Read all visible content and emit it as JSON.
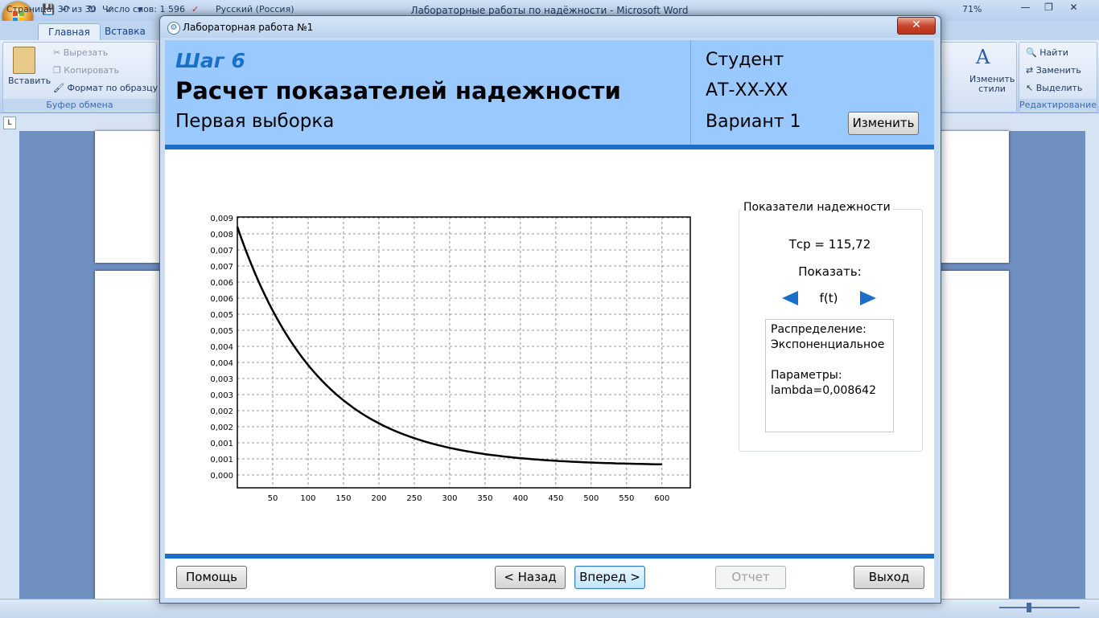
{
  "word": {
    "title": "Лабораторные работы по надёжности - Microsoft Word",
    "tabs": [
      "Главная",
      "Вставка"
    ],
    "clipboard": {
      "paste": "Вставить",
      "cut": "Вырезать",
      "copy": "Копировать",
      "format_painter": "Формат по образцу",
      "group_label": "Буфер обмена"
    },
    "styles": {
      "change_styles": "Изменить стили"
    },
    "editing": {
      "find": "Найти",
      "replace": "Заменить",
      "select": "Выделить",
      "group_label": "Редактирование"
    },
    "status": {
      "page": "Страница: 30 из 30",
      "words": "Число слов: 1 596",
      "language": "Русский (Россия)",
      "zoom": "71%"
    }
  },
  "dialog": {
    "title": "Лабораторная работа №1",
    "header": {
      "step": "Шаг 6",
      "title": "Расчет показателей надежности",
      "subtitle": "Первая выборка",
      "student": "Студент",
      "group": "АТ-XX-XX",
      "variant": "Вариант 1",
      "change_button": "Изменить"
    },
    "panel": {
      "legend": "Показатели надежности",
      "tcp": "Тср = 115,72",
      "show_label": "Показать:",
      "function": "f(t)",
      "distribution_label": "Распределение:",
      "distribution_value": "Экспоненциальное",
      "params_label": "Параметры:",
      "params_value": "lambda=0,008642"
    },
    "buttons": {
      "help": "Помощь",
      "back": "< Назад",
      "next": "Вперед >",
      "report": "Отчет",
      "exit": "Выход"
    }
  },
  "chart_data": {
    "type": "line",
    "title": "",
    "xlabel": "",
    "ylabel": "",
    "xlim": [
      0,
      640
    ],
    "ylim": [
      -0.0008,
      0.009
    ],
    "x_ticks": [
      50,
      100,
      150,
      200,
      250,
      300,
      350,
      400,
      450,
      500,
      550,
      600
    ],
    "y_tick_labels": [
      "0,009",
      "0,008",
      "0,007",
      "0,007",
      "0,006",
      "0,006",
      "0,005",
      "0,005",
      "0,004",
      "0,004",
      "0,003",
      "0,003",
      "0,002",
      "0,002",
      "0,001",
      "0,001",
      "0,000"
    ],
    "grid": true,
    "series": [
      {
        "function": "f(t) = lambda * exp(-lambda * t)",
        "lambda": 0.008642,
        "x": [
          0,
          25,
          50,
          75,
          100,
          125,
          150,
          175,
          200,
          250,
          300,
          350,
          400,
          450,
          500,
          550,
          600
        ],
        "y": [
          0.00864,
          0.00698,
          0.00562,
          0.00453,
          0.00365,
          0.00294,
          0.00237,
          0.00191,
          0.00154,
          0.000999,
          0.000649,
          0.000421,
          0.000273,
          0.000177,
          0.000115,
          7.47e-05,
          4.84e-05
        ]
      }
    ]
  }
}
